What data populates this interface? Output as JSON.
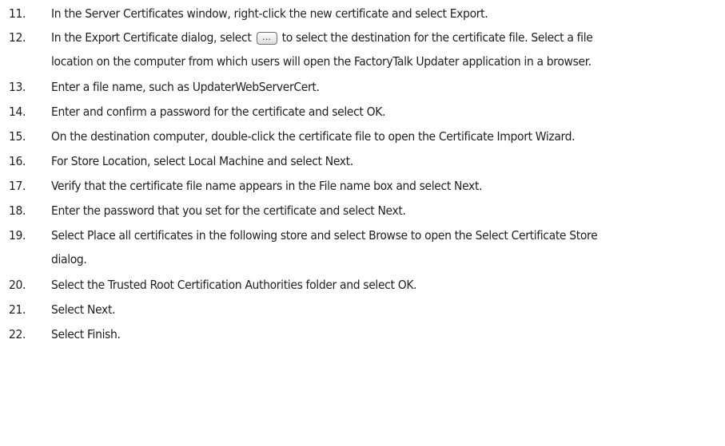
{
  "steps": [
    {
      "number": "11.",
      "lines": [
        "In the Server Certificates window, right-click the new certificate and select Export."
      ]
    },
    {
      "number": "12.",
      "line1_before": "In the Export Certificate dialog, select",
      "button_glyph": "…",
      "button_icon": "browse-ellipsis-button-icon",
      "line1_after": "to select the destination for the certificate file. Select a file",
      "line2": "location on the computer from which users will open the FactoryTalk Updater application in a browser."
    },
    {
      "number": "13.",
      "lines": [
        "Enter a file name, such as UpdaterWebServerCert."
      ]
    },
    {
      "number": "14.",
      "lines": [
        "Enter and confirm a password for the certificate and select OK."
      ]
    },
    {
      "number": "15.",
      "lines": [
        "On the destination computer, double-click the certificate file to open the Certificate Import Wizard."
      ]
    },
    {
      "number": "16.",
      "lines": [
        "For Store Location, select Local Machine and select Next."
      ]
    },
    {
      "number": "17.",
      "lines": [
        "Verify that the certificate file name appears in the File name box and select Next."
      ]
    },
    {
      "number": "18.",
      "lines": [
        "Enter the password that you set for the certificate and select Next."
      ]
    },
    {
      "number": "19.",
      "lines": [
        "Select Place all certificates in the following store and select Browse to open the Select Certificate Store",
        "dialog."
      ]
    },
    {
      "number": "20.",
      "lines": [
        "Select the Trusted Root Certification Authorities folder and select OK."
      ]
    },
    {
      "number": "21.",
      "lines": [
        "Select Next."
      ]
    },
    {
      "number": "22.",
      "lines": [
        "Select Finish."
      ]
    }
  ]
}
